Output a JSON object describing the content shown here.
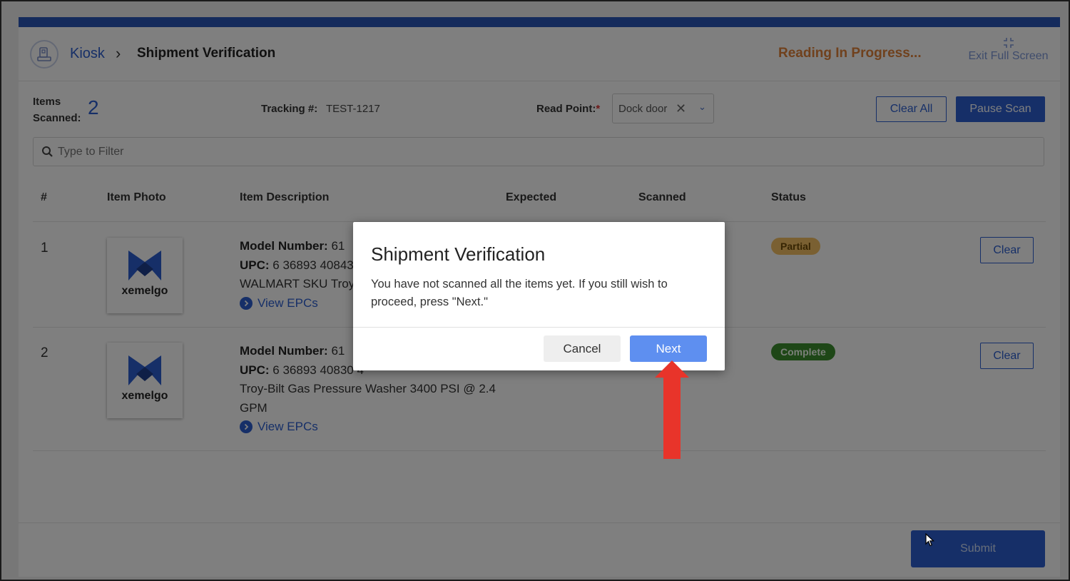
{
  "header": {
    "breadcrumb_root": "Kiosk",
    "breadcrumb_sep": "›",
    "breadcrumb_current": "Shipment Verification",
    "status_text": "Reading In Progress...",
    "exit_fullscreen_label": "Exit Full Screen"
  },
  "controls": {
    "items_scanned_label_1": "Items",
    "items_scanned_label_2": "Scanned:",
    "items_scanned_count": "2",
    "tracking_label": "Tracking #:",
    "tracking_value": "TEST-1217",
    "read_point_label": "Read Point:",
    "read_point_required": "*",
    "read_point_value": "Dock door",
    "clear_all_label": "Clear All",
    "pause_scan_label": "Pause Scan",
    "filter_placeholder": "Type to Filter"
  },
  "table": {
    "headers": {
      "num": "#",
      "photo": "Item Photo",
      "description": "Item Description",
      "expected": "Expected",
      "scanned": "Scanned",
      "status": "Status"
    },
    "rows": [
      {
        "num": "1",
        "photo_brand": "xemelgo",
        "model_label": "Model Number:",
        "model_value": "61",
        "upc_label": "UPC:",
        "upc_value": "6 36893 40843",
        "name": "WALMART SKU Troy",
        "view_epcs": "View EPCs",
        "status": "Partial",
        "clear_label": "Clear"
      },
      {
        "num": "2",
        "photo_brand": "xemelgo",
        "model_label": "Model Number:",
        "model_value": "61",
        "upc_label": "UPC:",
        "upc_value": "6 36893 40830 4",
        "name": "Troy-Bilt Gas Pressure Washer 3400 PSI @ 2.4 GPM",
        "view_epcs": "View EPCs",
        "status": "Complete",
        "clear_label": "Clear"
      }
    ]
  },
  "footer": {
    "submit_label": "Submit"
  },
  "modal": {
    "title": "Shipment Verification",
    "message": "You have not scanned all the items yet. If you still wish to proceed, press \"Next.\"",
    "cancel_label": "Cancel",
    "next_label": "Next"
  },
  "colors": {
    "brand_blue": "#2c5fd0",
    "status_orange": "#e0823a",
    "badge_partial": "#f4c164",
    "badge_complete": "#3c8f2f",
    "next_button": "#5e8ff0",
    "annotation_arrow": "#e8342a"
  },
  "icons": [
    "kiosk-scanner-icon",
    "exit-fullscreen-icon",
    "clear-x-icon",
    "chevron-down-icon",
    "search-icon",
    "xemelgo-logo",
    "chevron-right-circle-icon",
    "mouse-cursor-icon",
    "red-arrow-annotation"
  ]
}
